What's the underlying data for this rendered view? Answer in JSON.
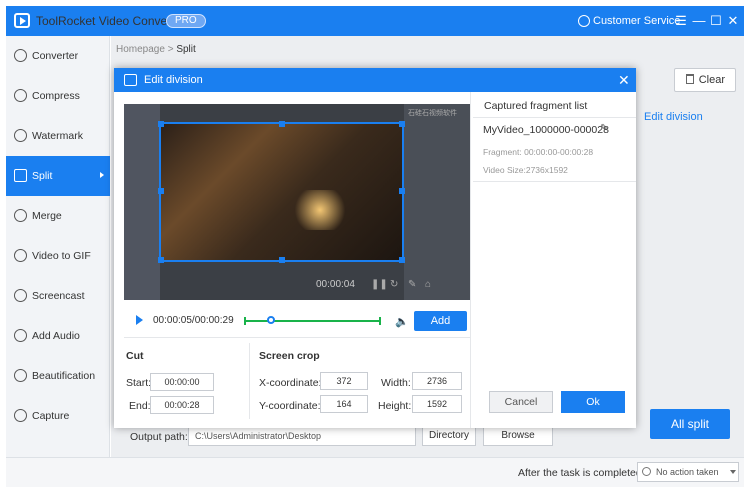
{
  "app": {
    "title": "ToolRocket Video Converter",
    "badge": "PRO",
    "customer_service": "Customer Service"
  },
  "window_controls": {
    "menu": "☰",
    "minimize": "—",
    "maximize": "☐",
    "close": "✕"
  },
  "sidebar": {
    "items": [
      {
        "label": "Converter"
      },
      {
        "label": "Compress"
      },
      {
        "label": "Watermark"
      },
      {
        "label": "Split",
        "active": true
      },
      {
        "label": "Merge"
      },
      {
        "label": "Video to GIF"
      },
      {
        "label": "Screencast"
      },
      {
        "label": "Add Audio"
      },
      {
        "label": "Beautification"
      },
      {
        "label": "Capture"
      }
    ]
  },
  "breadcrumb": {
    "home": "Homepage",
    "sep": ">",
    "current": "Split"
  },
  "main": {
    "clear_label": "Clear",
    "edit_division_label": "Edit division",
    "all_split_label": "All split",
    "output_label": "Output path:",
    "output_value": "C:\\Users\\Administrator\\Desktop",
    "directory_label": "Directory",
    "browse_label": "Browse"
  },
  "status": {
    "after_label": "After the task is completed",
    "after_value": "No action taken"
  },
  "dialog": {
    "title": "Edit division",
    "close": "✕",
    "watermark": "石硅石视频软件",
    "overlay_time": "00:00:04",
    "time_display": "00:00:05/00:00:29",
    "add_label": "Add",
    "cut": {
      "heading": "Cut",
      "start_label": "Start:",
      "start_value": "00:00:00",
      "end_label": "End:",
      "end_value": "00:00:28"
    },
    "crop": {
      "heading": "Screen crop",
      "x_label": "X-coordinate:",
      "x_value": "372",
      "width_label": "Width:",
      "width_value": "2736",
      "y_label": "Y-coordinate:",
      "y_value": "164",
      "height_label": "Height:",
      "height_value": "1592"
    },
    "fragments": {
      "title": "Captured fragment list",
      "name": "MyVideo_1000000-000028",
      "range": "Fragment: 00:00:00-00:00:28",
      "size": "Video Size:2736x1592"
    },
    "cancel_label": "Cancel",
    "ok_label": "Ok"
  },
  "colors": {
    "accent": "#1a7ff0",
    "trim": "#19b34a"
  }
}
